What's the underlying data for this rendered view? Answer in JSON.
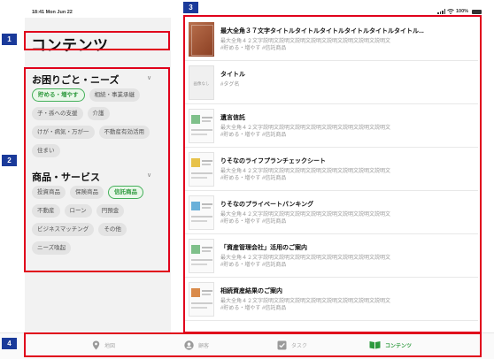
{
  "status_bar": {
    "time": "18:41  Mon Jun 22",
    "battery": "100%"
  },
  "page_title": "コンテンツ",
  "sections": [
    {
      "title": "お困りごと・ニーズ",
      "chips": [
        {
          "label": "貯める・増やす",
          "active": true
        },
        {
          "label": "相続・事業承継",
          "active": false
        },
        {
          "label": "子・孫への支援",
          "active": false
        },
        {
          "label": "介護",
          "active": false
        },
        {
          "label": "けが・病気・万が一",
          "active": false
        },
        {
          "label": "不動産有効活用",
          "active": false
        },
        {
          "label": "住まい",
          "active": false
        }
      ]
    },
    {
      "title": "商品・サービス",
      "chips": [
        {
          "label": "投資商品",
          "active": false
        },
        {
          "label": "保険商品",
          "active": false
        },
        {
          "label": "信託商品",
          "active": true
        },
        {
          "label": "不動産",
          "active": false
        },
        {
          "label": "ローン",
          "active": false
        },
        {
          "label": "円預金",
          "active": false
        },
        {
          "label": "ビジネスマッチング",
          "active": false
        },
        {
          "label": "その他",
          "active": false
        },
        {
          "label": "ニーズ喚起",
          "active": false
        }
      ]
    }
  ],
  "items": [
    {
      "thumb": "book",
      "title": "最大全角３７文字タイトルタイトルタイトルタイトルタイトルタイトル...",
      "desc": "最大全角４２文字説明文説明文説明文説明文説明文説明文説明文説明文",
      "tags": "#貯める・増やす  #信託商品"
    },
    {
      "thumb": "none",
      "thumb_text": "画像なし",
      "title": "タイトル",
      "desc": "",
      "tags": "#タグ名"
    },
    {
      "thumb": "doc",
      "title": "遺言信託",
      "desc": "最大全角４２文字説明文説明文説明文説明文説明文説明文説明文説明文",
      "tags": "#貯める・増やす  #信託商品"
    },
    {
      "thumb": "doc y",
      "title": "りそなのライフプランチェックシート",
      "desc": "最大全角４２文字説明文説明文説明文説明文説明文説明文説明文説明文",
      "tags": "#貯める・増やす  #信託商品"
    },
    {
      "thumb": "doc b",
      "title": "りそなのプライベートバンキング",
      "desc": "最大全角４２文字説明文説明文説明文説明文説明文説明文説明文説明文",
      "tags": "#貯める・増やす  #信託商品"
    },
    {
      "thumb": "doc",
      "title": "「資産管理会社」活用のご案内",
      "desc": "最大全角４２文字説明文説明文説明文説明文説明文説明文説明文説明文",
      "tags": "#貯める・増やす  #信託商品"
    },
    {
      "thumb": "doc o",
      "title": "相続資産結果のご案内",
      "desc": "最大全角４２文字説明文説明文説明文説明文説明文説明文説明文説明文",
      "tags": "#貯める・増やす  #信託商品"
    }
  ],
  "tabbar": [
    {
      "label": "地図",
      "icon": "map-pin-icon",
      "active": false
    },
    {
      "label": "顧客",
      "icon": "person-icon",
      "active": false
    },
    {
      "label": "タスク",
      "icon": "checkbox-icon",
      "active": false
    },
    {
      "label": "コンテンツ",
      "icon": "book-icon",
      "active": true
    }
  ],
  "annotations": [
    "1",
    "2",
    "3",
    "4"
  ],
  "colors": {
    "accent": "#2e9a3e",
    "annotation_box": "#e0001b",
    "annotation_tag": "#1a3a9a"
  }
}
